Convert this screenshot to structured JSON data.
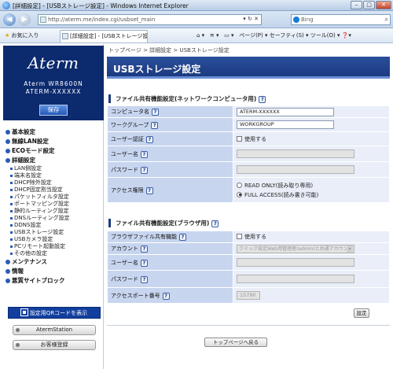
{
  "window": {
    "title": "[詳細設定] - [USBストレージ設定] - Windows Internet Explorer",
    "url": "http://aterm.me/index.cgi/usbset_main",
    "search_placeholder": "Bing",
    "favorites_label": "お気に入り",
    "tab_label": "[詳細設定] - [USBストレージ設定]",
    "commands": "ページ(P) ▾  セーフティ(S) ▾  ツール(O) ▾  ❓▾"
  },
  "sidebar": {
    "logo": "Aterm",
    "model": "Aterm WR8600N",
    "serial": "ATERM-XXXXXX",
    "save_label": "保存",
    "menu": [
      {
        "label": "基本設定"
      },
      {
        "label": "無線LAN設定"
      },
      {
        "label": "ECOモード設定"
      },
      {
        "label": "詳細設定"
      }
    ],
    "sub_items": [
      "LAN側設定",
      "端末名設定",
      "DHCP除外設定",
      "DHCP固定割当設定",
      "パケットフィルタ設定",
      "ポートマッピング設定",
      "静的ルーティング設定",
      "DNSルーティング設定",
      "DDNS設定",
      "USBストレージ設定",
      "USBカメラ設定",
      "PCリモート起動設定",
      "その他の設定"
    ],
    "menu_after": [
      {
        "label": "メンテナンス"
      },
      {
        "label": "情報"
      },
      {
        "label": "悪質サイトブロック"
      }
    ],
    "qr_label": "設定用QRコードを表示",
    "aterm_station_label": "AtermStation",
    "customer_label": "お客様登録"
  },
  "main": {
    "breadcrumb": "トップページ > 詳細設定 > USBストレージ設定",
    "page_title": "USBストレージ設定",
    "help_glyph": "?",
    "section1_title": "ファイル共有機能設定(ネットワークコンピュータ用)",
    "section1": {
      "computer_name_label": "コンピュータ名",
      "computer_name_value": "ATERM-XXXXXX",
      "workgroup_label": "ワークグループ",
      "workgroup_value": "WORKGROUP",
      "user_auth_label": "ユーザー認証",
      "user_auth_option": "使用する",
      "username_label": "ユーザー名",
      "password_label": "パスワード",
      "access_label": "アクセス権限",
      "access_readonly": "READ ONLY(読み取り専用)",
      "access_full": "FULL ACCESS(読み書き可能)"
    },
    "section2_title": "ファイル共有機能設定(ブラウザ用)",
    "section2": {
      "browser_share_label": "ブラウザファイル共有機能",
      "browser_share_option": "使用する",
      "account_label": "アカウント",
      "account_value": "クイック設定Web用管理者(admin)と共通アカウント",
      "username_label": "ユーザー名",
      "password_label": "パスワード",
      "port_label": "アクセスポート番号",
      "port_value": "15790"
    },
    "set_label": "設定",
    "top_label": "トップページへ戻る"
  }
}
